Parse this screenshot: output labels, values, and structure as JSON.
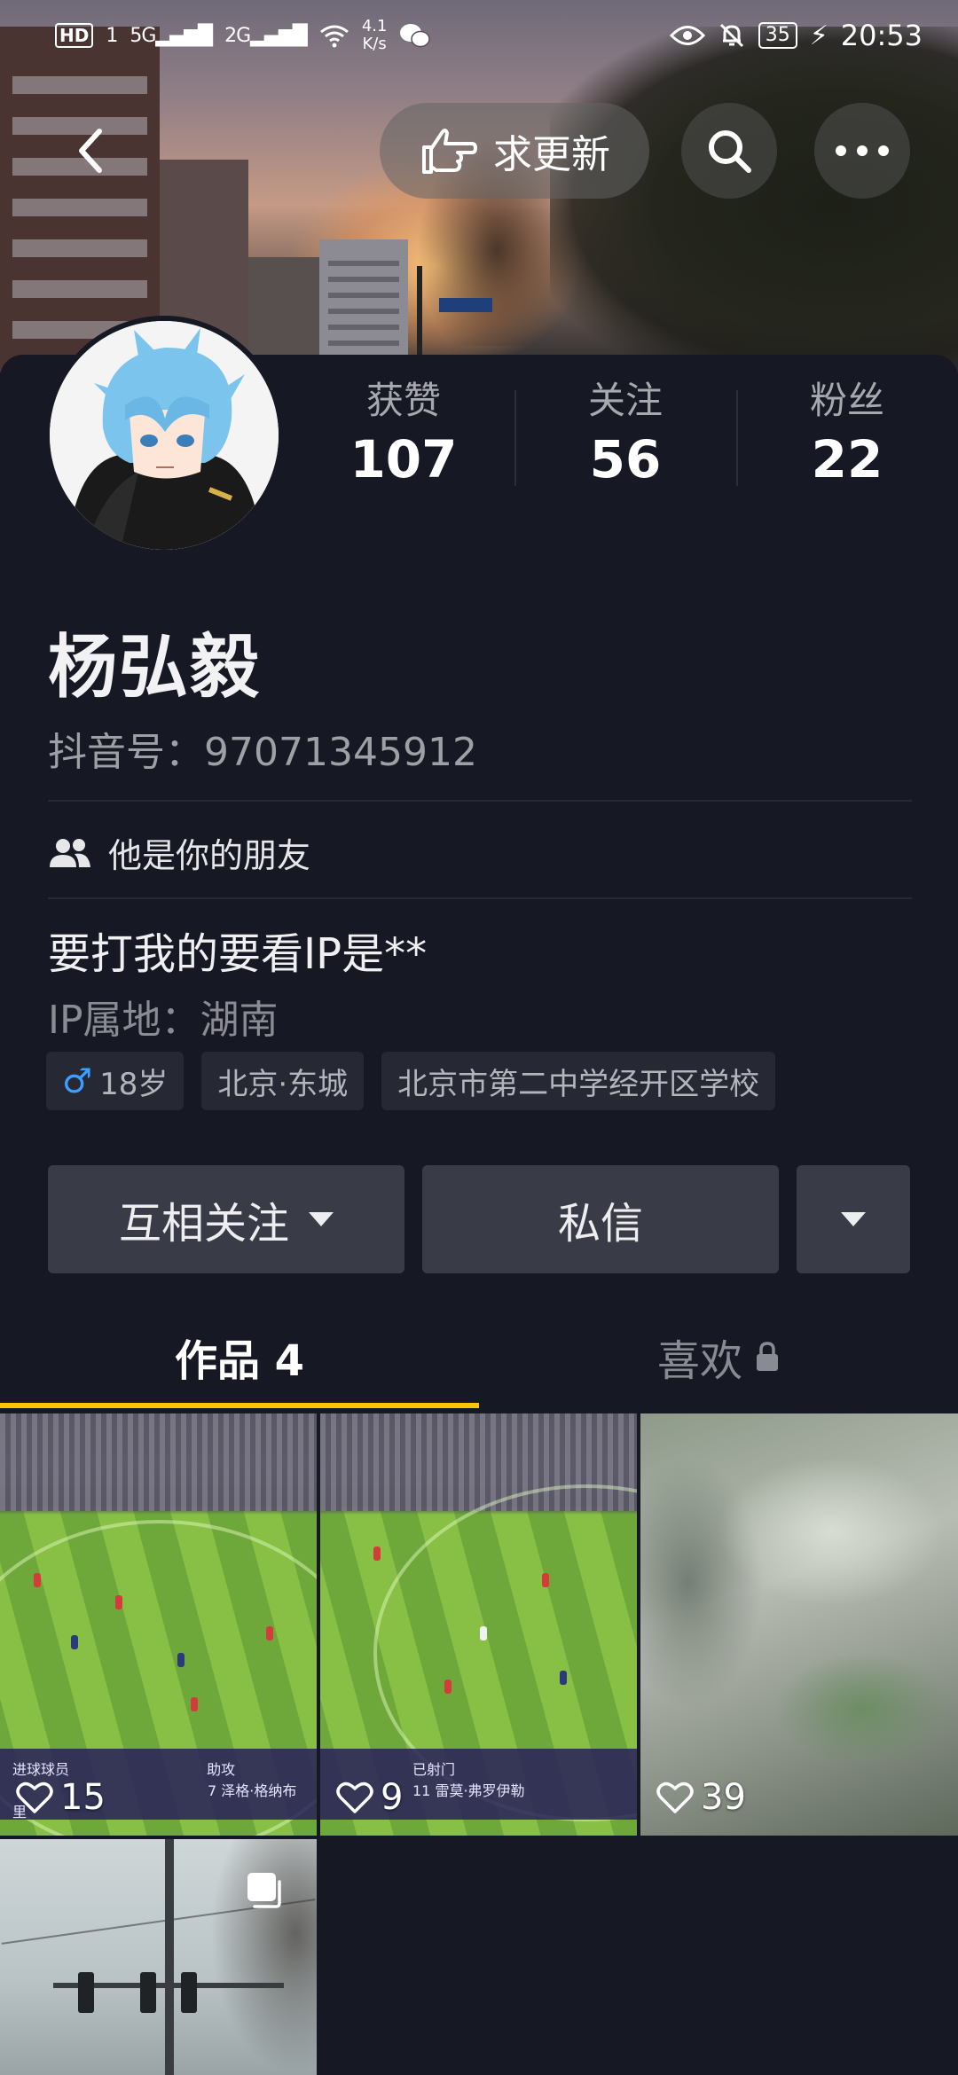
{
  "status_bar": {
    "hd": "HD",
    "sim": "1",
    "sig1": "5G",
    "sig2": "2G",
    "net_speed_value": "4.1",
    "net_speed_unit": "K/s",
    "battery": "35",
    "time": "20:53"
  },
  "top_nav": {
    "update_label": "求更新"
  },
  "profile": {
    "stats": [
      {
        "label": "获赞",
        "value": "107"
      },
      {
        "label": "关注",
        "value": "56"
      },
      {
        "label": "粉丝",
        "value": "22"
      }
    ],
    "name": "杨弘毅",
    "douyin_id": "抖音号：97071345912",
    "friend_text": "他是你的朋友",
    "bio": "要打我的要看IP是**",
    "ip": "IP属地：湖南",
    "tags": {
      "age": "18岁",
      "location": "北京·东城",
      "school": "北京市第二中学经开区学校"
    }
  },
  "actions": {
    "follow_label": "互相关注",
    "message_label": "私信"
  },
  "tabs": {
    "works_label": "作品 4",
    "likes_label": "喜欢"
  },
  "videos": [
    {
      "likes": "15",
      "overlay_left": "进球球员",
      "overlay_right": "助攻",
      "overlay_sub": "7 泽格·格纳布里"
    },
    {
      "likes": "9",
      "overlay_left": "已射门",
      "overlay_sub": "11 雷莫·弗罗伊勒"
    },
    {
      "likes": "39"
    },
    {}
  ],
  "colors": {
    "background": "#161823",
    "tab_underline": "#fbc500",
    "button_bg": "#393b46",
    "tag_bg": "#262834"
  }
}
